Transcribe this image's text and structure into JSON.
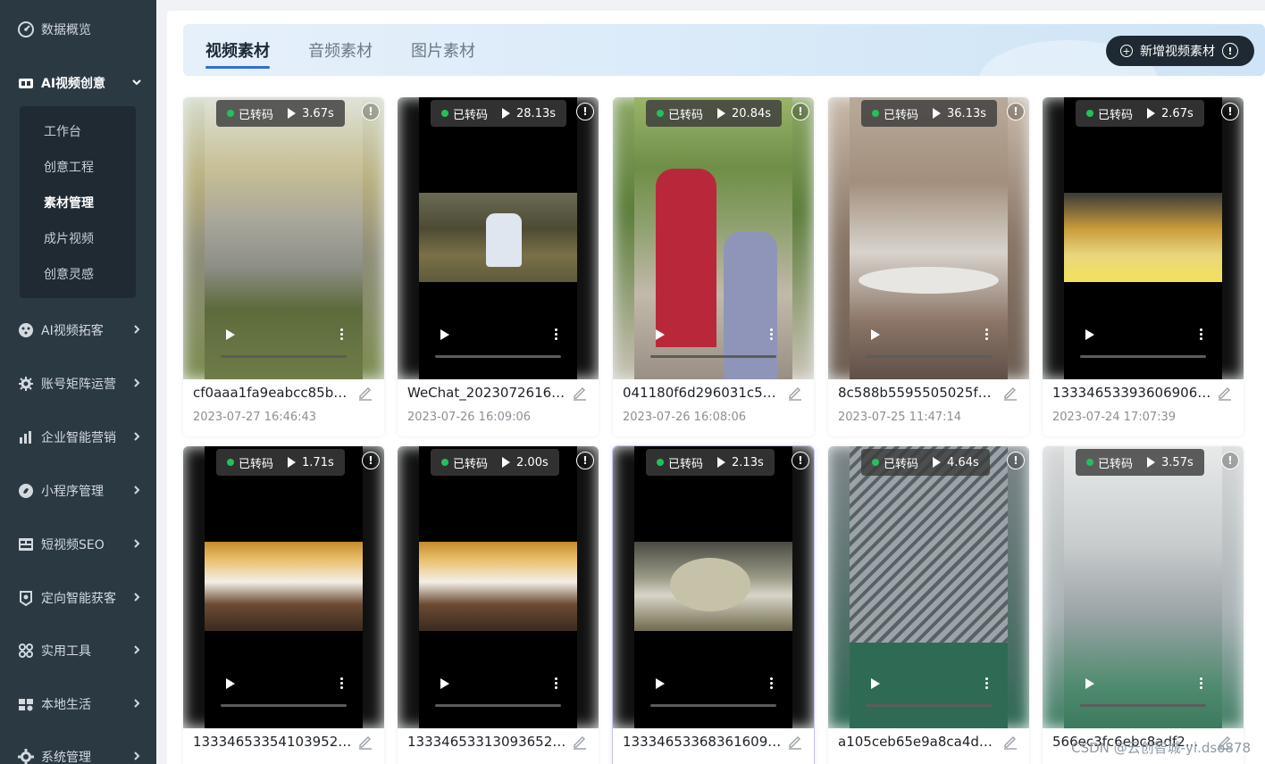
{
  "sidebar": {
    "items": [
      {
        "label": "数据概览",
        "icon": "dashboard-icon",
        "has_arrow": false
      },
      {
        "label": "AI视频创意",
        "icon": "video-create-icon",
        "has_arrow": true,
        "expanded": true
      },
      {
        "label": "AI视频拓客",
        "icon": "acquire-icon",
        "has_arrow": true
      },
      {
        "label": "账号矩阵运营",
        "icon": "matrix-icon",
        "has_arrow": true
      },
      {
        "label": "企业智能营销",
        "icon": "marketing-icon",
        "has_arrow": true
      },
      {
        "label": "小程序管理",
        "icon": "miniprogram-icon",
        "has_arrow": true
      },
      {
        "label": "短视频SEO",
        "icon": "seo-icon",
        "has_arrow": true
      },
      {
        "label": "定向智能获客",
        "icon": "target-icon",
        "has_arrow": true
      },
      {
        "label": "实用工具",
        "icon": "tools-icon",
        "has_arrow": true
      },
      {
        "label": "本地生活",
        "icon": "local-life-icon",
        "has_arrow": true
      },
      {
        "label": "系统管理",
        "icon": "settings-icon",
        "has_arrow": true
      }
    ],
    "submenu": [
      "工作台",
      "创意工程",
      "素材管理",
      "成片视频",
      "创意灵感"
    ],
    "submenu_active": "素材管理"
  },
  "tabs": [
    "视频素材",
    "音频素材",
    "图片素材"
  ],
  "active_tab": "视频素材",
  "add_button": {
    "label": "新增视频素材",
    "info": "!"
  },
  "status_label": "已转码",
  "info_symbol": "!",
  "cards": [
    {
      "name": "cf0aaa1fa9eabcc85b8...",
      "date": "2023-07-27 16:46:43",
      "duration": "3.67s",
      "scene": "wetland"
    },
    {
      "name": "WeChat_20230726160...",
      "date": "2023-07-26 16:09:06",
      "duration": "28.13s",
      "scene": "grass"
    },
    {
      "name": "041180f6d296031c56...",
      "date": "2023-07-26 16:08:06",
      "duration": "20.84s",
      "scene": "park"
    },
    {
      "name": "8c588b5595505025fd...",
      "date": "2023-07-25 11:47:14",
      "duration": "36.13s",
      "scene": "interior"
    },
    {
      "name": "13334653393606906....",
      "date": "2023-07-24 17:07:39",
      "duration": "2.67s",
      "scene": "shop"
    },
    {
      "name": "13334653354103952....",
      "date": "",
      "duration": "1.71s",
      "scene": "mall"
    },
    {
      "name": "13334653313093652....",
      "date": "",
      "duration": "2.00s",
      "scene": "mall"
    },
    {
      "name": "13334653368361609....",
      "date": "",
      "duration": "2.13s",
      "scene": "food"
    },
    {
      "name": "a105ceb65e9a8ca4d1...",
      "date": "",
      "duration": "4.64s",
      "scene": "pipes"
    },
    {
      "name": "566ec3fc6ebc8adf2...",
      "date": "",
      "duration": "3.57s",
      "scene": "warehouse"
    }
  ],
  "watermark": "CSDN @云创智城-yi.dso878",
  "colors": {
    "sidebar_bg": "#2b3943",
    "accent": "#2f6fd6",
    "status_green": "#21c15e"
  }
}
